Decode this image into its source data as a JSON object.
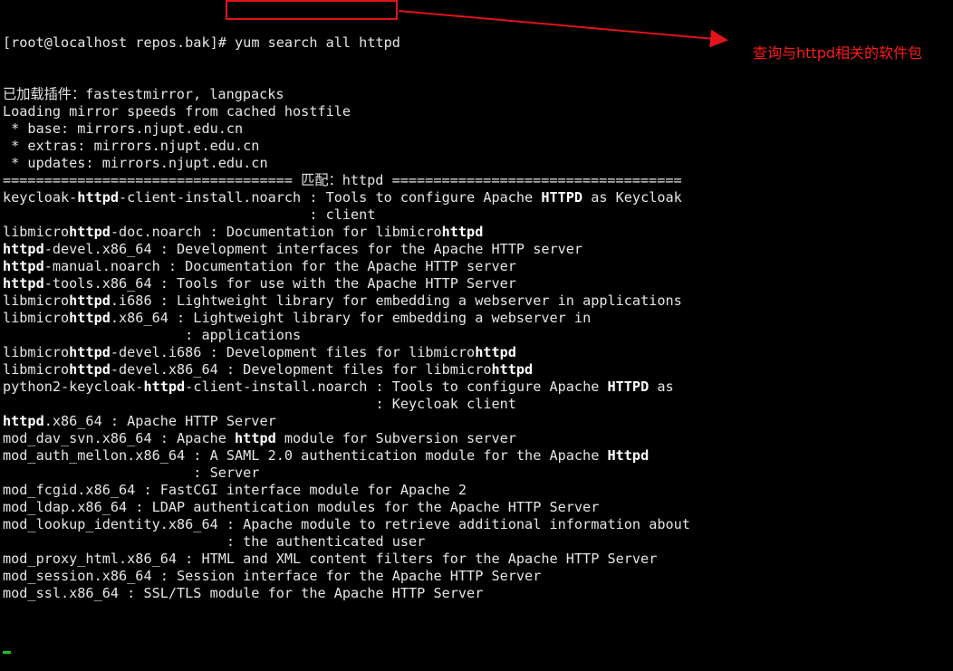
{
  "terminal": {
    "prompt": "[root@localhost repos.bak]# ",
    "command": "yum search all httpd",
    "lines": [
      [
        [
          "已加载插件：fastestmirror, langpacks",
          false
        ]
      ],
      [
        [
          "Loading mirror speeds from cached hostfile",
          false
        ]
      ],
      [
        [
          " * base: mirrors.njupt.edu.cn",
          false
        ]
      ],
      [
        [
          " * extras: mirrors.njupt.edu.cn",
          false
        ]
      ],
      [
        [
          " * updates: mirrors.njupt.edu.cn",
          false
        ]
      ],
      [
        [
          "=================================== 匹配：httpd ===================================",
          false
        ]
      ],
      [
        [
          "keycloak-",
          false
        ],
        [
          "httpd",
          true
        ],
        [
          "-client-install.noarch : Tools to configure Apache ",
          false
        ],
        [
          "HTTPD",
          true
        ],
        [
          " as Keycloak",
          false
        ]
      ],
      [
        [
          "                                     : client",
          false
        ]
      ],
      [
        [
          "libmicro",
          false
        ],
        [
          "httpd",
          true
        ],
        [
          "-doc.noarch : Documentation for libmicro",
          false
        ],
        [
          "httpd",
          true
        ]
      ],
      [
        [
          "httpd",
          true
        ],
        [
          "-devel.x86_64 : Development interfaces for the Apache HTTP server",
          false
        ]
      ],
      [
        [
          "httpd",
          true
        ],
        [
          "-manual.noarch : Documentation for the Apache HTTP server",
          false
        ]
      ],
      [
        [
          "httpd",
          true
        ],
        [
          "-tools.x86_64 : Tools for use with the Apache HTTP Server",
          false
        ]
      ],
      [
        [
          "libmicro",
          false
        ],
        [
          "httpd",
          true
        ],
        [
          ".i686 : Lightweight library for embedding a webserver in applications",
          false
        ]
      ],
      [
        [
          "libmicro",
          false
        ],
        [
          "httpd",
          true
        ],
        [
          ".x86_64 : Lightweight library for embedding a webserver in",
          false
        ]
      ],
      [
        [
          "                      : applications",
          false
        ]
      ],
      [
        [
          "libmicro",
          false
        ],
        [
          "httpd",
          true
        ],
        [
          "-devel.i686 : Development files for libmicro",
          false
        ],
        [
          "httpd",
          true
        ]
      ],
      [
        [
          "libmicro",
          false
        ],
        [
          "httpd",
          true
        ],
        [
          "-devel.x86_64 : Development files for libmicro",
          false
        ],
        [
          "httpd",
          true
        ]
      ],
      [
        [
          "python2-keycloak-",
          false
        ],
        [
          "httpd",
          true
        ],
        [
          "-client-install.noarch : Tools to configure Apache ",
          false
        ],
        [
          "HTTPD",
          true
        ],
        [
          " as",
          false
        ]
      ],
      [
        [
          "                                             : Keycloak client",
          false
        ]
      ],
      [
        [
          "httpd",
          true
        ],
        [
          ".x86_64 : Apache HTTP Server",
          false
        ]
      ],
      [
        [
          "mod_dav_svn.x86_64 : Apache ",
          false
        ],
        [
          "httpd",
          true
        ],
        [
          " module for Subversion server",
          false
        ]
      ],
      [
        [
          "mod_auth_mellon.x86_64 : A SAML 2.0 authentication module for the Apache ",
          false
        ],
        [
          "Httpd",
          true
        ]
      ],
      [
        [
          "                       : Server",
          false
        ]
      ],
      [
        [
          "mod_fcgid.x86_64 : FastCGI interface module for Apache 2",
          false
        ]
      ],
      [
        [
          "mod_ldap.x86_64 : LDAP authentication modules for the Apache HTTP Server",
          false
        ]
      ],
      [
        [
          "mod_lookup_identity.x86_64 : Apache module to retrieve additional information about",
          false
        ]
      ],
      [
        [
          "                           : the authenticated user",
          false
        ]
      ],
      [
        [
          "mod_proxy_html.x86_64 : HTML and XML content filters for the Apache HTTP Server",
          false
        ]
      ],
      [
        [
          "mod_session.x86_64 : Session interface for the Apache HTTP Server",
          false
        ]
      ],
      [
        [
          "mod_ssl.x86_64 : SSL/TLS module for the Apache HTTP Server",
          false
        ]
      ]
    ]
  },
  "annotation": {
    "text": "查询与httpd相关的软件包",
    "color": "#ff1a1a"
  },
  "colors": {
    "background": "#000000",
    "text": "#e5e5e5",
    "bold_text": "#ffffff",
    "highlight_box": "#e0141a",
    "cursor": "#19c31b"
  }
}
